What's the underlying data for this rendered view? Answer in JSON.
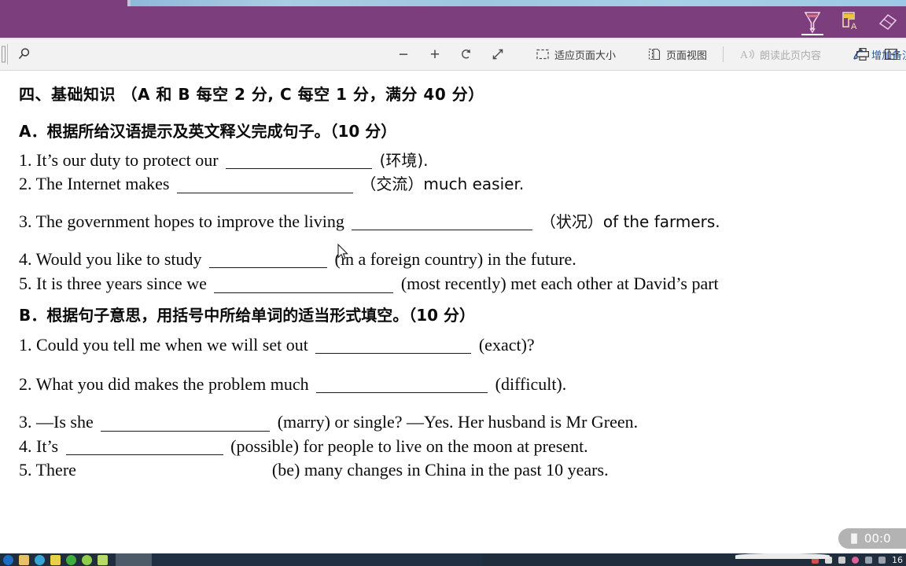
{
  "ink_toolbar": {
    "tools": [
      {
        "name": "pen-tool",
        "label": "Pen",
        "color": "#e8b9c8",
        "active": true
      },
      {
        "name": "highlighter-tool",
        "label": "Highlighter",
        "color": "#f5d76e",
        "active": false
      },
      {
        "name": "eraser-tool",
        "label": "Eraser",
        "color": "#e3c6e3",
        "active": false
      }
    ],
    "background_color": "#7d3e7d"
  },
  "command_bar": {
    "search_icon_label": "search-icon",
    "zoom_out_label": "−",
    "zoom_in_label": "+",
    "rotate_label": "rotate",
    "fullscreen_label": "fullscreen",
    "fit_page_label": "适应页面大小",
    "page_view_label": "页面视图",
    "read_aloud_label": "朗读此页内容",
    "add_note_label": "增加备注",
    "print_label": "print",
    "more_label": "more",
    "accent_color": "#2b579a"
  },
  "document": {
    "heading": "四、基础知识 （A 和 B 每空 2 分, C 每空 1 分，满分 40 分）",
    "section_a": {
      "title": "A．根据所给汉语提示及英文释义完成句子。（10 分）",
      "items": [
        {
          "num": "1.",
          "before": "It’s our duty to protect our",
          "blank_width": 186,
          "after": "(环境)."
        },
        {
          "num": "2.",
          "before": "The Internet makes",
          "blank_width": 224,
          "after": "（交流）much easier."
        },
        {
          "num": "3.",
          "before": "The government hopes to improve the living",
          "blank_width": 230,
          "after": "（状况）of the farmers."
        },
        {
          "num": "4.",
          "before": "Would you like to study",
          "blank_width": 150,
          "after": "(in a foreign country) in the future."
        },
        {
          "num": "5.",
          "before": "It is three years since we",
          "blank_width": 228,
          "after": "(most recently) met each other at David’s part"
        }
      ]
    },
    "section_b": {
      "title": "B．根据句子意思，用括号中所给单词的适当形式填空。（10 分）",
      "items": [
        {
          "num": "1.",
          "before": "Could you tell me when we will set out",
          "blank_width": 198,
          "after": "(exact)?"
        },
        {
          "num": "2.",
          "before": "What you did makes the problem much",
          "blank_width": 218,
          "after": "(difficult)."
        },
        {
          "num": "3.",
          "before": "—Is she",
          "blank_width": 215,
          "after": "(marry) or single?     —Yes. Her husband is Mr Green."
        },
        {
          "num": "4.",
          "before": "It’s",
          "blank_width": 200,
          "after": "(possible) for people to live on the moon at present."
        },
        {
          "num": "5.",
          "before": "There",
          "blank_width": 230,
          "after": "(be) many changes in China in the past 10 years."
        }
      ]
    }
  },
  "recording_timer": {
    "icon": "pause-icon",
    "time": "00:0"
  },
  "taskbar": {
    "clock": "16",
    "apps": [
      {
        "name": "edge-icon",
        "color": "#1b6ec2"
      },
      {
        "name": "folder-icon",
        "color": "#e8c06a"
      },
      {
        "name": "browser-icon",
        "color": "#36a6d6"
      },
      {
        "name": "app-icon",
        "color": "#e8d04a"
      },
      {
        "name": "wechat-icon",
        "color": "#3fae3f"
      },
      {
        "name": "qq-icon",
        "color": "#8fce4a"
      },
      {
        "name": "note-icon",
        "color": "#b7d96a"
      }
    ],
    "tray": [
      {
        "name": "tray-icon-1",
        "color": "#d05050"
      },
      {
        "name": "tray-icon-2",
        "color": "#dddddd"
      },
      {
        "name": "tray-icon-3",
        "color": "#cccccc"
      },
      {
        "name": "tray-icon-4",
        "color": "#e0609b"
      },
      {
        "name": "network-icon",
        "color": "#d0d0d0"
      },
      {
        "name": "volume-icon",
        "color": "#d0d0d0"
      }
    ]
  }
}
